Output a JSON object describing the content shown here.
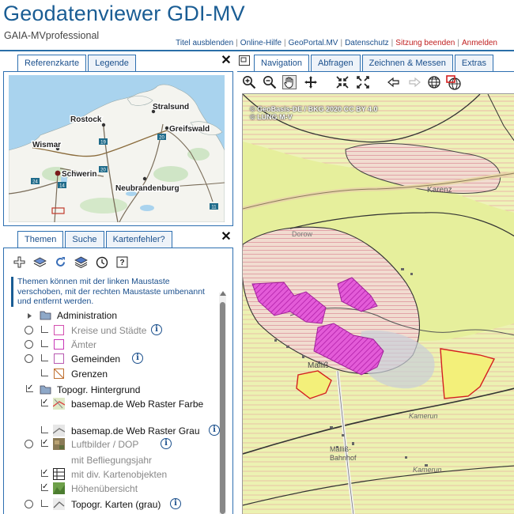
{
  "header": {
    "title": "Geodatenviewer GDI-MV",
    "subtitle": "GAIA-MVprofessional",
    "links": [
      {
        "label": "Titel ausblenden",
        "red": false
      },
      {
        "label": "Online-Hilfe",
        "red": false
      },
      {
        "label": "GeoPortal.MV",
        "red": false
      },
      {
        "label": "Datenschutz",
        "red": false
      },
      {
        "label": "Sitzung beenden",
        "red": true
      },
      {
        "label": "Anmelden",
        "red": true
      }
    ]
  },
  "left_top_tabs": {
    "ref": "Referenzkarte",
    "legend": "Legende"
  },
  "ref_map": {
    "cities": {
      "stralsund": "Stralsund",
      "rostock": "Rostock",
      "greifswald": "Greifswald",
      "wismar": "Wismar",
      "schwerin": "Schwerin",
      "neubrandenburg": "Neubrandenburg"
    },
    "road_badges": {
      "a": "19",
      "b": "20",
      "c": "20",
      "d": "24",
      "e": "14",
      "f": "11"
    }
  },
  "left_bottom_tabs": {
    "themes": "Themen",
    "search": "Suche",
    "errors": "Kartenfehler?"
  },
  "info_text": "Themen können mit der linken Maustaste verschoben, mit der rechten Maustaste umbenannt und entfernt werden.",
  "layers": {
    "administration": "Administration",
    "kreise": "Kreise und Städte",
    "aemter": "Ämter",
    "gemeinden": "Gemeinden",
    "grenzen": "Grenzen",
    "topo_bg": "Topogr. Hintergrund",
    "raster_farbe": "basemap.de Web Raster Farbe",
    "raster_grau": "basemap.de Web Raster Grau",
    "luftbilder": "Luftbilder / DOP",
    "befliegung": "mit Befliegungsjahr",
    "kartenobjekte": "mit div. Kartenobjekten",
    "hoehen": "Höhenübersicht",
    "topo_karten": "Topogr. Karten (grau)"
  },
  "right_tabs": {
    "navigation": "Navigation",
    "abfragen": "Abfragen",
    "zeichnen": "Zeichnen & Messen",
    "extras": "Extras"
  },
  "map": {
    "copyright_line1": "© GeoBasis-DE / BKG 2020 CC BY 4.0",
    "copyright_line2": "© LUNG M-V",
    "labels": {
      "karenz": "Karenz",
      "dorow": "Dorow",
      "mallis": "Malliß",
      "mallis_bahnhof_1": "Malliß-",
      "mallis_bahnhof_2": "Bahnhof",
      "kamerun1": "Kamerun",
      "kamerun2": "Kamerun"
    }
  },
  "colors": {
    "brand": "#1a5d94",
    "tab_border": "#2d6fb0",
    "link_red": "#c02020",
    "map_base": "#e6ef9c",
    "restriction_magenta": "#d633c8"
  }
}
